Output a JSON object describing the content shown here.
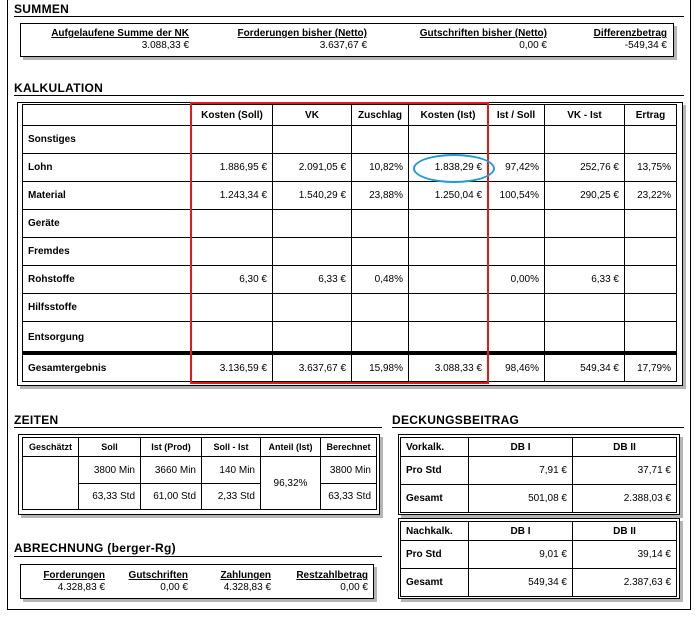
{
  "summen": {
    "title": "SUMMEN",
    "items": [
      {
        "label": "Aufgelaufene Summe der NK",
        "value": "3.088,33 €"
      },
      {
        "label": "Forderungen bisher (Netto)",
        "value": "3.637,67 €"
      },
      {
        "label": "Gutschriften bisher (Netto)",
        "value": "0,00 €"
      },
      {
        "label": "Differenzbetrag",
        "value": "-549,34 €"
      }
    ]
  },
  "kalkulation": {
    "title": "KALKULATION",
    "columns": [
      "Kosten (Soll)",
      "VK",
      "Zuschlag",
      "Kosten (Ist)",
      "Ist / Soll",
      "VK - Ist",
      "Ertrag"
    ],
    "rows": [
      {
        "label": "Sonstiges",
        "cells": [
          "",
          "",
          "",
          "",
          "",
          "",
          ""
        ]
      },
      {
        "label": "Lohn",
        "cells": [
          "1.886,95 €",
          "2.091,05 €",
          "10,82%",
          "1.838,29 €",
          "97,42%",
          "252,76 €",
          "13,75%"
        ]
      },
      {
        "label": "Material",
        "cells": [
          "1.243,34 €",
          "1.540,29 €",
          "23,88%",
          "1.250,04 €",
          "100,54%",
          "290,25 €",
          "23,22%"
        ]
      },
      {
        "label": "Geräte",
        "cells": [
          "",
          "",
          "",
          "",
          "",
          "",
          ""
        ]
      },
      {
        "label": "Fremdes",
        "cells": [
          "",
          "",
          "",
          "",
          "",
          "",
          ""
        ]
      },
      {
        "label": "Rohstoffe",
        "cells": [
          "6,30 €",
          "6,33 €",
          "0,48%",
          "",
          "0,00%",
          "6,33 €",
          ""
        ]
      },
      {
        "label": "Hilfsstoffe",
        "cells": [
          "",
          "",
          "",
          "",
          "",
          "",
          ""
        ]
      },
      {
        "label": "Entsorgung",
        "cells": [
          "",
          "",
          "",
          "",
          "",
          "",
          ""
        ]
      }
    ],
    "total": {
      "label": "Gesamtergebnis",
      "cells": [
        "3.136,59 €",
        "3.637,67 €",
        "15,98%",
        "3.088,33 €",
        "98,46%",
        "549,34 €",
        "17,79%"
      ]
    }
  },
  "zeiten": {
    "title": "ZEITEN",
    "columns": [
      "Geschätzt",
      "Soll",
      "Ist (Prod)",
      "Soll - Ist",
      "Anteil (Ist)",
      "Berechnet"
    ],
    "row1": [
      "3800 Min",
      "3660 Min",
      "140 Min",
      "3800 Min"
    ],
    "row2": [
      "63,33 Std",
      "61,00 Std",
      "2,33 Std",
      "63,33 Std"
    ],
    "anteil": "96,32%"
  },
  "deckungsbeitrag": {
    "title": "DECKUNGSBEITRAG",
    "vor": {
      "header": "Vorkalk.",
      "db1": "DB I",
      "db2": "DB II",
      "rows": [
        {
          "label": "Pro Std",
          "v1": "7,91 €",
          "v2": "37,71 €"
        },
        {
          "label": "Gesamt",
          "v1": "501,08 €",
          "v2": "2.388,03 €"
        }
      ]
    },
    "nach": {
      "header": "Nachkalk.",
      "db1": "DB I",
      "db2": "DB II",
      "rows": [
        {
          "label": "Pro Std",
          "v1": "9,01 €",
          "v2": "39,14 €"
        },
        {
          "label": "Gesamt",
          "v1": "549,34 €",
          "v2": "2.387,63 €"
        }
      ]
    }
  },
  "abrechnung": {
    "title": "ABRECHNUNG (berger-Rg)",
    "items": [
      {
        "label": "Forderungen",
        "value": "4.328,83 €"
      },
      {
        "label": "Gutschriften",
        "value": "0,00 €"
      },
      {
        "label": "Zahlungen",
        "value": "4.328,83 €"
      },
      {
        "label": "Restzahlbetrag",
        "value": "0,00 €"
      }
    ]
  },
  "colors": {
    "highlight_box": "#e01b1b",
    "ellipse": "#1e9ad6",
    "shadow": "#b5b5b5"
  }
}
